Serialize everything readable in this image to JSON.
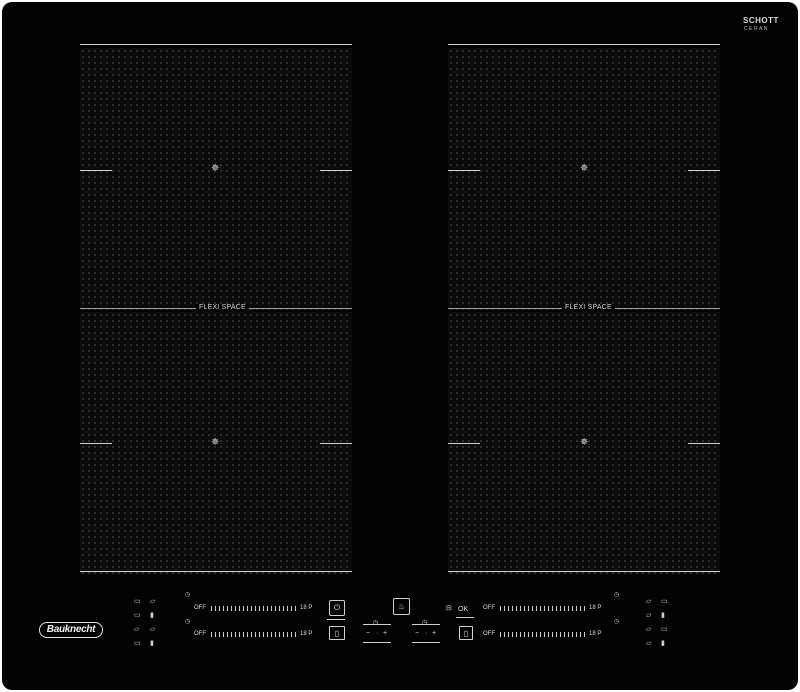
{
  "brand": {
    "glass_top": "SCHOTT",
    "glass_bottom": "CERAN",
    "logo_text": "Bauknecht"
  },
  "zones": {
    "flexi_label": "FLEXI SPACE",
    "center_symbol": "✵"
  },
  "sliders": {
    "off_label": "OFF",
    "max_label": "18 P"
  },
  "controls": {
    "timer_symbol": "◷",
    "minus": "−",
    "plus": "+",
    "dot": "·",
    "ok_label": "OK",
    "power_icon": "power-icon",
    "pot_icon": "pot-icon"
  },
  "colors": {
    "glass": "#020202",
    "markings": "#d0d0d0"
  }
}
